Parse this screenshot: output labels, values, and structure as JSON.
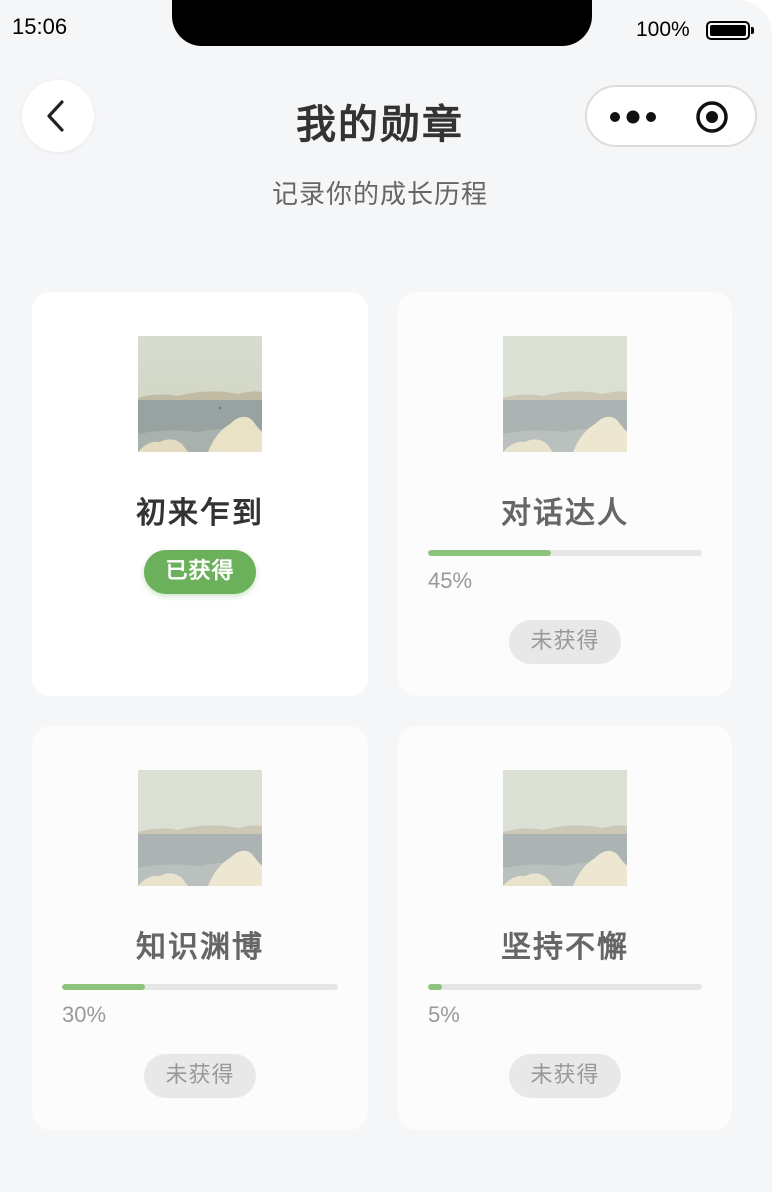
{
  "status_bar": {
    "time": "15:06",
    "battery_percent": "100%"
  },
  "header": {
    "title": "我的勋章",
    "subtitle": "记录你的成长历程"
  },
  "badges": [
    {
      "name": "初来乍到",
      "status": "已获得",
      "earned": true
    },
    {
      "name": "对话达人",
      "status": "未获得",
      "earned": false,
      "progress": 0.45,
      "progress_text": "45%"
    },
    {
      "name": "知识渊博",
      "status": "未获得",
      "earned": false,
      "progress": 0.3,
      "progress_text": "30%"
    },
    {
      "name": "坚持不懈",
      "status": "未获得",
      "earned": false,
      "progress": 0.05,
      "progress_text": "5%"
    }
  ],
  "colors": {
    "accent_green": "#6bb05a",
    "progress_green": "#8cc47d",
    "background": "#f5f6f8"
  },
  "icons": {
    "back": "chevron-left-icon",
    "more": "more-dots-icon",
    "close": "target-circle-icon",
    "badge_image": "cloud-landscape-image"
  }
}
